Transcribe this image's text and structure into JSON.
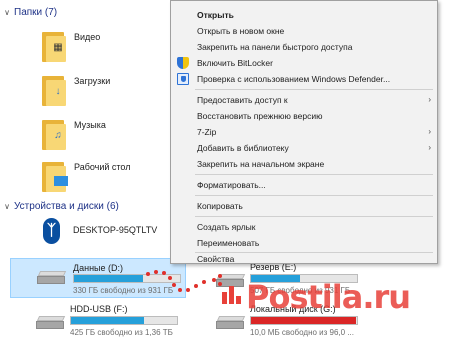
{
  "explorer": {
    "folders_header": "Папки (7)",
    "devices_header": "Устройства и диски (6)",
    "folders": [
      {
        "label": "Видео",
        "icon": "video-folder-icon"
      },
      {
        "label": "Загрузки",
        "icon": "downloads-folder-icon"
      },
      {
        "label": "Музыка",
        "icon": "music-folder-icon"
      },
      {
        "label": "Рабочий стол",
        "icon": "desktop-folder-icon"
      }
    ],
    "device": {
      "label": "DESKTOP-95QTLTV",
      "icon": "bluetooth-icon"
    },
    "drives": [
      {
        "name": "Данные (D:)",
        "free": "330 ГБ свободно из 931 ГБ",
        "used_fraction": 0.65,
        "selected": true
      },
      {
        "name": "Резерв (E:)",
        "free": "507 ГБ свободно из 931 ГБ",
        "used_fraction": 0.46,
        "selected": false
      },
      {
        "name": "HDD-USB (F:)",
        "free": "425 ГБ свободно из 1,36 ТБ",
        "used_fraction": 0.69,
        "selected": false
      },
      {
        "name": "Локальный диск (G:)",
        "free": "10,0 МБ свободно из 96,0 ...",
        "used_fraction": 0.99,
        "selected": false
      }
    ]
  },
  "context_menu": {
    "items": [
      {
        "label": "Открыть",
        "bold": true
      },
      {
        "label": "Открыть в новом окне"
      },
      {
        "label": "Закрепить на панели быстрого доступа"
      },
      {
        "label": "Включить BitLocker",
        "icon": "bitlocker-shield-icon"
      },
      {
        "label": "Проверка с использованием Windows Defender...",
        "icon": "windows-defender-icon"
      },
      {
        "label": "Предоставить доступ к",
        "submenu": true
      },
      {
        "label": "Восстановить прежнюю версию"
      },
      {
        "label": "7-Zip",
        "submenu": true
      },
      {
        "label": "Добавить в библиотеку",
        "submenu": true
      },
      {
        "label": "Закрепить на начальном экране"
      },
      {
        "label": "Форматировать..."
      },
      {
        "label": "Копировать"
      },
      {
        "label": "Создать ярлык"
      },
      {
        "label": "Переименовать"
      },
      {
        "label": "Свойства"
      }
    ],
    "submenu_arrow": "›"
  },
  "watermark": "Postila.ru",
  "colors": {
    "accent_blue": "#26a0da",
    "header_blue": "#1e3287",
    "selection": "#cce8ff",
    "folder_yellow": "#f8d775",
    "arrow_red": "#e0302b"
  }
}
